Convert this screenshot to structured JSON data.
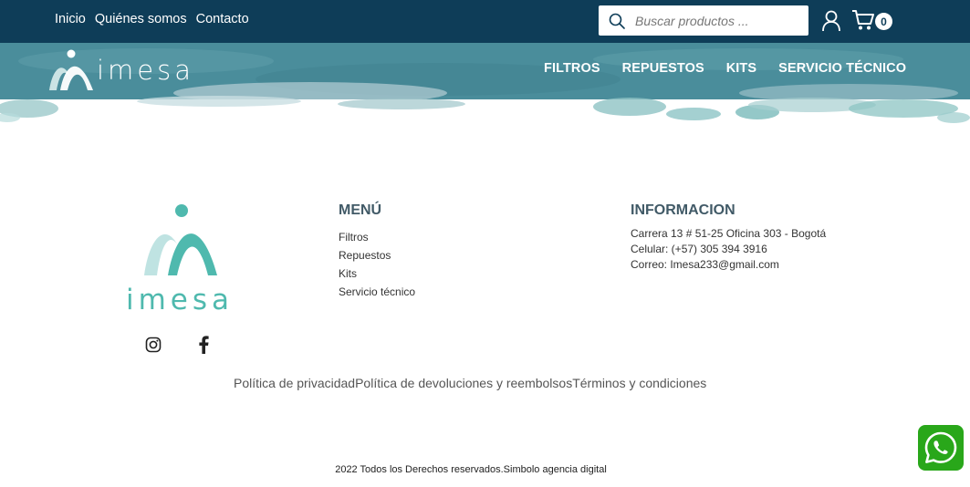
{
  "topbar": {
    "links": [
      "Inicio",
      "Quiénes somos",
      "Contacto"
    ],
    "search_placeholder": "Buscar productos ...",
    "cart_count": "0"
  },
  "header": {
    "brand": "imesa",
    "nav": [
      "FILTROS",
      "REPUESTOS",
      "KITS",
      "SERVICIO TÉCNICO"
    ]
  },
  "footer": {
    "logo_word": "imesa",
    "menu_title": "MENÚ",
    "menu_items": [
      "Filtros",
      "Repuestos",
      "Kits",
      "Servicio técnico"
    ],
    "info_title": "INFORMACION",
    "info_lines": [
      "Carrera 13 # 51-25 Oficina 303 - Bogotá",
      "Celular: (+57) 305 394 3916",
      "Correo: Imesa233@gmail.com"
    ],
    "legal_links": [
      "Política de privacidad",
      "Política de devoluciones y reembolsos",
      "Términos y condiciones"
    ],
    "copyright": "2022 Todos los Derechos reservados.Simbolo agencia digital"
  },
  "colors": {
    "topbar": "#0e3d58",
    "navband": "#4a8d9b",
    "brand_teal": "#4fb9ae",
    "whatsapp": "#29a71a"
  },
  "icons": {
    "search": "search-icon",
    "user": "user-icon",
    "cart": "cart-icon",
    "instagram": "instagram-icon",
    "facebook": "facebook-icon",
    "whatsapp": "whatsapp-icon"
  }
}
